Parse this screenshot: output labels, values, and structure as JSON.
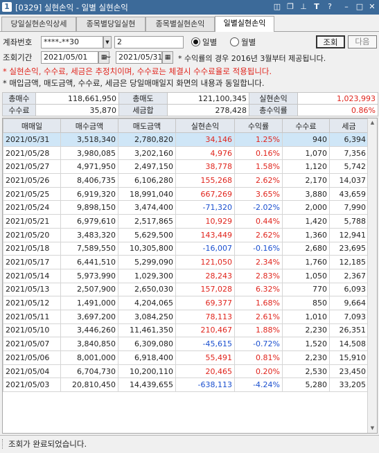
{
  "window": {
    "icon": "1",
    "title": "[0329] 실현손익 - 일별 실현손익",
    "controls": [
      "restore-icon",
      "copy-icon",
      "pin-icon",
      "font-icon",
      "help-icon",
      "minimize-icon",
      "maximize-icon",
      "close-icon"
    ]
  },
  "tabs": [
    "당일실현손익상세",
    "종목별당일실현",
    "종목별실현손익",
    "일별실현손익"
  ],
  "form": {
    "account_label": "계좌번호",
    "account_value": "****-**30",
    "account_sub": "2",
    "period_label": "조회기간",
    "date_from": "2021/05/01",
    "date_sep": "~",
    "date_to": "2021/05/31",
    "radio_daily": "일별",
    "radio_monthly": "월별",
    "search_btn": "조회",
    "next_btn": "다음",
    "period_note": "* 수익률의 경우 2016년 3월부터 제공됩니다."
  },
  "notices": {
    "red": "* 실현손익, 수수료, 세금은 추정치이며, 수수료는 체결시 수수료율로 적용됩니다.",
    "black": "* 매입금액, 매도금액, 수수료, 세금은 당일매매일지 화면의 내용과 동일합니다."
  },
  "summary": {
    "total_buy_label": "총매수",
    "total_buy": "118,661,950",
    "total_sell_label": "총매도",
    "total_sell": "121,100,345",
    "realized_label": "실현손익",
    "realized": "1,023,993",
    "fee_label": "수수료",
    "fee": "35,870",
    "tax_label": "세금합",
    "tax": "278,428",
    "yield_label": "총수익률",
    "yield": "0.86%"
  },
  "table": {
    "headers": [
      "매매일",
      "매수금액",
      "매도금액",
      "실현손익",
      "수익률",
      "수수료",
      "세금"
    ],
    "rows": [
      [
        "2021/05/31",
        "3,518,340",
        "2,780,820",
        "34,146",
        "1.25%",
        "940",
        "6,394"
      ],
      [
        "2021/05/28",
        "3,980,085",
        "3,202,160",
        "4,976",
        "0.16%",
        "1,070",
        "7,356"
      ],
      [
        "2021/05/27",
        "4,971,950",
        "2,497,150",
        "38,778",
        "1.58%",
        "1,120",
        "5,742"
      ],
      [
        "2021/05/26",
        "8,406,735",
        "6,106,280",
        "155,268",
        "2.62%",
        "2,170",
        "14,037"
      ],
      [
        "2021/05/25",
        "6,919,320",
        "18,991,040",
        "667,269",
        "3.65%",
        "3,880",
        "43,659"
      ],
      [
        "2021/05/24",
        "9,898,150",
        "3,474,400",
        "-71,320",
        "-2.02%",
        "2,000",
        "7,990"
      ],
      [
        "2021/05/21",
        "6,979,610",
        "2,517,865",
        "10,929",
        "0.44%",
        "1,420",
        "5,788"
      ],
      [
        "2021/05/20",
        "3,483,320",
        "5,629,500",
        "143,449",
        "2.62%",
        "1,360",
        "12,941"
      ],
      [
        "2021/05/18",
        "7,589,550",
        "10,305,800",
        "-16,007",
        "-0.16%",
        "2,680",
        "23,695"
      ],
      [
        "2021/05/17",
        "6,441,510",
        "5,299,090",
        "121,050",
        "2.34%",
        "1,760",
        "12,185"
      ],
      [
        "2021/05/14",
        "5,973,990",
        "1,029,300",
        "28,243",
        "2.83%",
        "1,050",
        "2,367"
      ],
      [
        "2021/05/13",
        "2,507,900",
        "2,650,030",
        "157,028",
        "6.32%",
        "770",
        "6,093"
      ],
      [
        "2021/05/12",
        "1,491,000",
        "4,204,065",
        "69,377",
        "1.68%",
        "850",
        "9,664"
      ],
      [
        "2021/05/11",
        "3,697,200",
        "3,084,250",
        "78,113",
        "2.61%",
        "1,010",
        "7,093"
      ],
      [
        "2021/05/10",
        "3,446,260",
        "11,461,350",
        "210,467",
        "1.88%",
        "2,230",
        "26,351"
      ],
      [
        "2021/05/07",
        "3,840,850",
        "6,309,080",
        "-45,615",
        "-0.72%",
        "1,520",
        "14,508"
      ],
      [
        "2021/05/06",
        "8,001,000",
        "6,918,400",
        "55,491",
        "0.81%",
        "2,230",
        "15,910"
      ],
      [
        "2021/05/04",
        "6,704,730",
        "10,200,110",
        "20,465",
        "0.20%",
        "2,530",
        "23,450"
      ],
      [
        "2021/05/03",
        "20,810,450",
        "14,439,655",
        "-638,113",
        "-4.24%",
        "5,280",
        "33,205"
      ]
    ]
  },
  "status": {
    "text": "조회가 완료되었습니다."
  },
  "colors": {
    "positive": "#e0241c",
    "negative": "#1a4fcf",
    "title_bar": "#3c6a99",
    "selected_row": "#cfe6f7"
  }
}
